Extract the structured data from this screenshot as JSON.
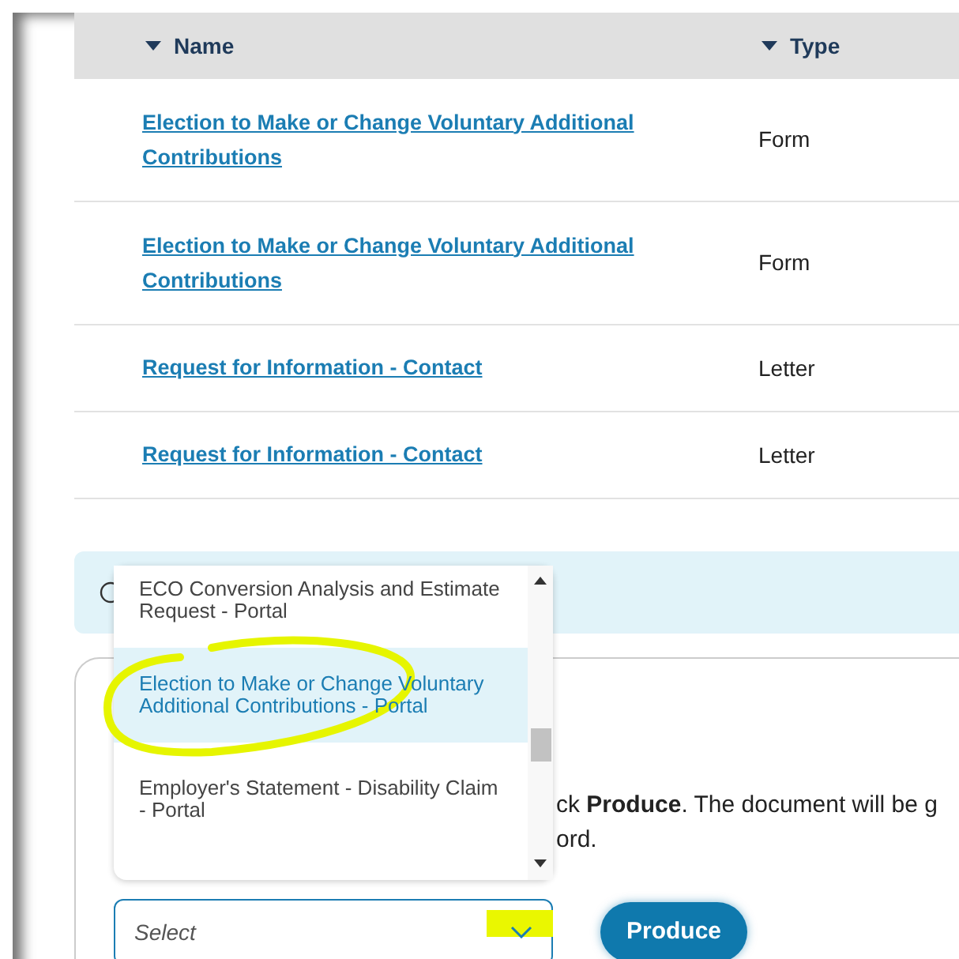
{
  "table": {
    "columns": [
      "Name",
      "Type"
    ],
    "rows": [
      {
        "name": "Election to Make or Change Voluntary Additional Contributions",
        "type": "Form"
      },
      {
        "name": "Election to Make or Change Voluntary Additional Contributions",
        "type": "Form"
      },
      {
        "name": "Request for Information - Contact",
        "type": "Letter"
      },
      {
        "name": "Request for Information - Contact",
        "type": "Letter"
      }
    ]
  },
  "instructions": [
    "ck **Produce**. The document will be g",
    "ord."
  ],
  "dropdown": {
    "options": [
      {
        "label": "ECO Conversion Analysis and Estimate Request - Portal",
        "selected": false
      },
      {
        "label": "Election to Make or Change Voluntary Additional Contributions - Portal",
        "selected": true
      },
      {
        "label": "Employer's Statement - Disability Claim - Portal",
        "selected": false
      }
    ]
  },
  "select": {
    "placeholder": "Select"
  },
  "button": "Produce"
}
